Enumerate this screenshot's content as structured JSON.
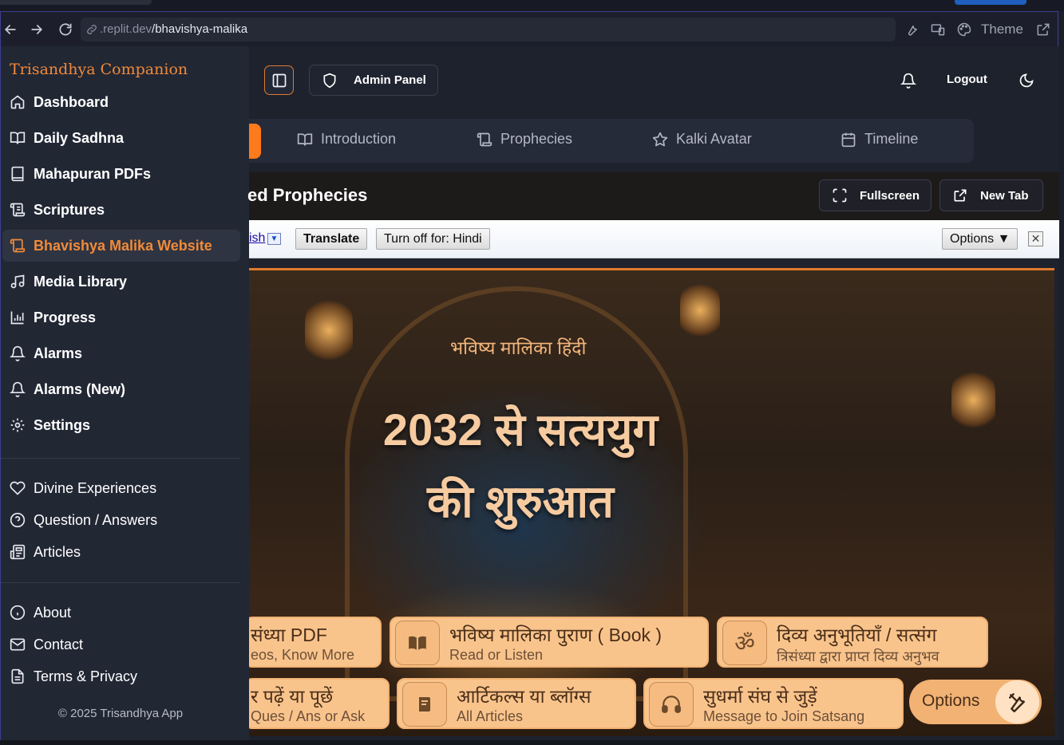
{
  "browser": {
    "url_dim": ".replit.dev",
    "url_path": "/bhavishya-malika",
    "theme_label": "Theme"
  },
  "sidebar": {
    "brand": "Trisandhya Companion",
    "items": [
      {
        "label": "Dashboard",
        "icon": "home-icon"
      },
      {
        "label": "Daily Sadhna",
        "icon": "book-open-icon"
      },
      {
        "label": "Mahapuran PDFs",
        "icon": "book-icon"
      },
      {
        "label": "Scriptures",
        "icon": "scroll-icon"
      },
      {
        "label": "Bhavishya Malika Website",
        "icon": "scroll-icon",
        "active": true
      },
      {
        "label": "Media Library",
        "icon": "music-icon"
      },
      {
        "label": "Progress",
        "icon": "bar-chart-icon"
      },
      {
        "label": "Alarms",
        "icon": "bell-icon"
      },
      {
        "label": "Alarms (New)",
        "icon": "bell-icon"
      },
      {
        "label": "Settings",
        "icon": "gear-icon"
      }
    ],
    "secondary": [
      {
        "label": "Divine Experiences",
        "icon": "heart-icon"
      },
      {
        "label": "Question / Answers",
        "icon": "help-circle-icon"
      },
      {
        "label": "Articles",
        "icon": "newspaper-icon"
      }
    ],
    "footer_links": [
      {
        "label": "About",
        "icon": "info-icon"
      },
      {
        "label": "Contact",
        "icon": "mail-icon"
      },
      {
        "label": "Terms & Privacy",
        "icon": "file-text-icon"
      }
    ],
    "copyright": "© 2025 Trisandhya App"
  },
  "header": {
    "admin_label": "Admin Panel",
    "logout_label": "Logout"
  },
  "tabs": [
    {
      "label": "Introduction",
      "icon": "book-open-icon"
    },
    {
      "label": "Prophecies",
      "icon": "scroll-icon"
    },
    {
      "label": "Kalki Avatar",
      "icon": "star-icon"
    },
    {
      "label": "Timeline",
      "icon": "calendar-icon"
    }
  ],
  "frame": {
    "title": "ed Prophecies",
    "fullscreen_label": "Fullscreen",
    "newtab_label": "New Tab"
  },
  "translate_bar": {
    "lang_fragment": "ish",
    "translate_label": "Translate",
    "turnoff_label": "Turn off for: Hindi",
    "options_label": "Options ▼",
    "close_label": "✕"
  },
  "hero": {
    "subtitle": "भविष्य मालिका हिंदी",
    "title_line1": "2032 से सत्ययुग",
    "title_line2": "की शुरुआत"
  },
  "cards": [
    {
      "title": "संध्या PDF",
      "sub": "eos, Know More"
    },
    {
      "title": "भविष्य मालिका पुराण ( Book )",
      "sub": "Read or Listen"
    },
    {
      "title": "दिव्य अनुभूतियाँ / सत्संग",
      "sub": "त्रिसंध्या द्वारा प्राप्त दिव्य अनुभव"
    },
    {
      "title": "र पढ़ें या पूछें",
      "sub": "Ques / Ans or Ask"
    },
    {
      "title": "आर्टिकल्स या ब्लॉग्स",
      "sub": "All Articles"
    },
    {
      "title": "सुधर्मा संघ से जुड़ें",
      "sub": "Message to Join Satsang"
    }
  ],
  "options_card": {
    "label": "Options"
  },
  "colors": {
    "accent": "#f08a3a",
    "sidebar_bg": "#222734",
    "card_bg": "#f9c48c"
  }
}
